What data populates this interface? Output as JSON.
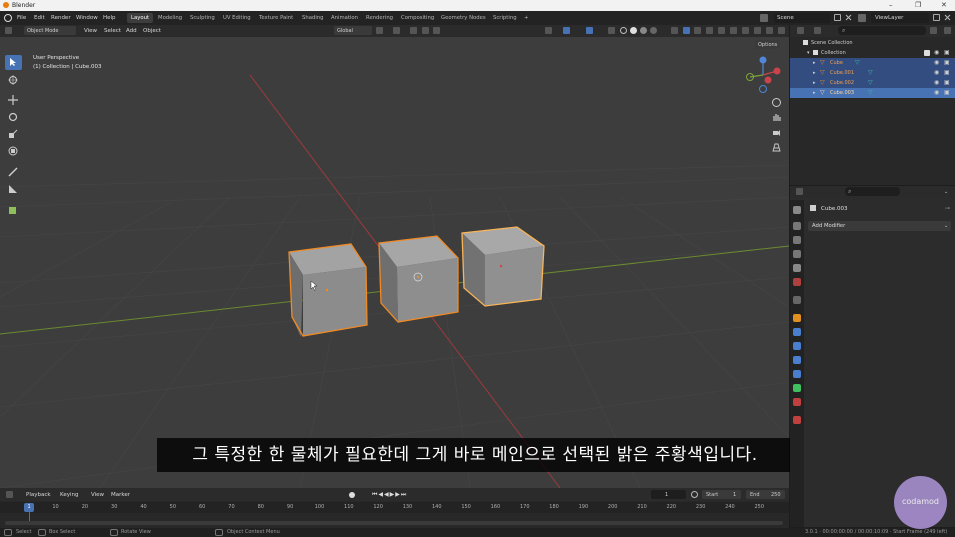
{
  "window": {
    "title": "Blender"
  },
  "menu": [
    "File",
    "Edit",
    "Render",
    "Window",
    "Help"
  ],
  "workspaces": [
    "Layout",
    "Modeling",
    "Sculpting",
    "UV Editing",
    "Texture Paint",
    "Shading",
    "Animation",
    "Rendering",
    "Compositing",
    "Geometry Nodes",
    "Scripting"
  ],
  "workspace_add": "+",
  "top_right": {
    "scene": "Scene",
    "view_layer": "ViewLayer"
  },
  "viewport_header": {
    "mode": "Object Mode",
    "menus": [
      "View",
      "Select",
      "Add",
      "Object"
    ],
    "orientation": "Global",
    "options_label": "Options"
  },
  "viewport_overlay": {
    "view_name": "User Perspective",
    "collection_info": "(1) Collection | Cube.003"
  },
  "outliner": {
    "scene_collection": "Scene Collection",
    "collection": "Collection",
    "items": [
      "Cube",
      "Cube.001",
      "Cube.002",
      "Cube.003"
    ]
  },
  "properties": {
    "object_name": "Cube.003",
    "add_modifier": "Add Modifier"
  },
  "timeline": {
    "menus": [
      "Playback",
      "Keying",
      "View",
      "Marker"
    ],
    "current_frame": "1",
    "start_label": "Start",
    "start_value": "1",
    "end_label": "End",
    "end_value": "250",
    "ticks": [
      "1",
      "10",
      "20",
      "30",
      "40",
      "50",
      "60",
      "70",
      "80",
      "90",
      "100",
      "110",
      "120",
      "130",
      "140",
      "150",
      "160",
      "170",
      "180",
      "190",
      "200",
      "210",
      "220",
      "230",
      "240",
      "250"
    ]
  },
  "statusbar": {
    "select": "Select",
    "box_select": "Box Select",
    "rotate_view": "Rotate View",
    "context_menu": "Object Context Menu",
    "info": "3.0.1 · 00:00:00:00 / 00:00:10:09 · Start Frame (249 left)"
  },
  "subtitle": "그 특정한 한 물체가 필요한데 그게 바로 메인으로 선택된 밝은 주황색입니다.",
  "watermark": "codamod",
  "colors": {
    "selection_orange": "#f08a24",
    "active_blue": "#4772b3",
    "x_axis": "#c8444a",
    "y_axis": "#7ea33b"
  }
}
